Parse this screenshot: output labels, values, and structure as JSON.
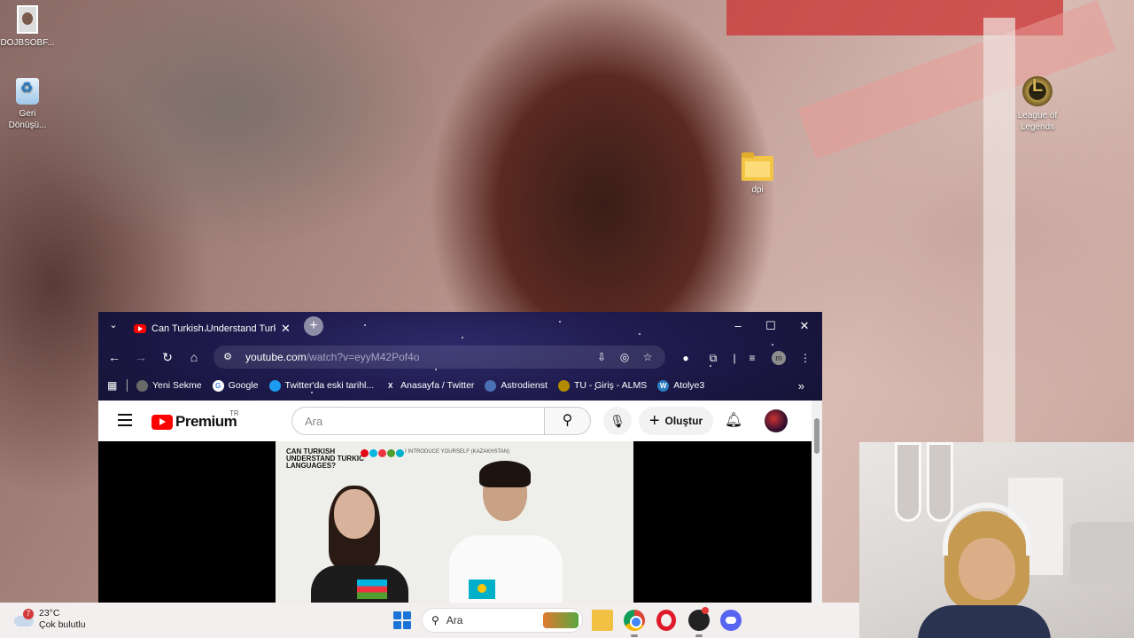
{
  "desktop": {
    "icons": [
      {
        "label": "DOJBSOBF...",
        "icon": "photo-icon"
      },
      {
        "label": "Geri Dönüşü...",
        "icon": "recycle-bin-icon"
      },
      {
        "label": "League of Legends",
        "icon": "league-of-legends-icon"
      },
      {
        "label": "dpi",
        "icon": "folder-icon"
      }
    ]
  },
  "browser": {
    "tab": {
      "title": "Can Turkish Understand Turkic L",
      "favicon": "youtube-icon"
    },
    "window_controls": {
      "minimize": "–",
      "maximize": "☐",
      "close": "✕"
    },
    "address": {
      "host": "youtube.com",
      "path": "/watch?v=eyyM42Pof4o"
    },
    "profile_initial": "m",
    "bookmarks": [
      {
        "label": "Yeni Sekme",
        "icon": "globe-icon",
        "color": "#6a6a6a"
      },
      {
        "label": "Google",
        "icon": "google-icon",
        "color": "#4285f4"
      },
      {
        "label": "Twitter'da eski tarihl...",
        "icon": "twitter-icon",
        "color": "#1d9bf0"
      },
      {
        "label": "Anasayfa / Twitter",
        "icon": "x-icon",
        "color": "#000000"
      },
      {
        "label": "Astrodienst",
        "icon": "astrodienst-icon",
        "color": "#4b6fb5"
      },
      {
        "label": "TU - Giriş - ALMS",
        "icon": "alms-icon",
        "color": "#b38b00"
      },
      {
        "label": "Atolye3",
        "icon": "wordpress-icon",
        "color": "#2a7ac0"
      }
    ]
  },
  "youtube": {
    "logo_text": "Premium",
    "country": "TR",
    "search_placeholder": "Ara",
    "create_label": "Oluştur",
    "video": {
      "title_overlay": "CAN TURKISH UNDERSTAND TURKIC LANGUAGES?",
      "subtitle_overlay": "I INTRODUCE YOURSELF (KAZAKHSTAN)"
    }
  },
  "taskbar": {
    "weather": {
      "temp": "23°C",
      "condition": "Çok bulutlu",
      "badge": "7"
    },
    "search_label": "Ara",
    "apps": [
      "windows-start-icon",
      "file-explorer-icon",
      "chrome-icon",
      "opera-icon",
      "obs-icon",
      "discord-icon"
    ]
  }
}
